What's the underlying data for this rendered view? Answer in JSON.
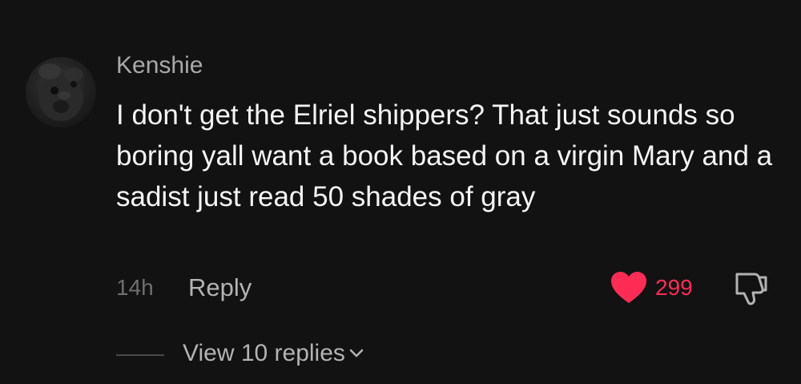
{
  "comment": {
    "username": "Kenshie",
    "text": "I don't get the Elriel shippers? That just sounds so boring yall want a book based on a virgin Mary and a sadist just read 50 shades of gray",
    "time": "14h",
    "reply_label": "Reply",
    "like_count": "299",
    "view_replies_label": "View 10 replies"
  },
  "icons": {
    "like": "heart-icon",
    "dislike": "thumbs-down-icon",
    "expand": "chevron-down-icon"
  },
  "colors": {
    "background": "#121212",
    "username": "#a9a9a9",
    "text": "#f5f5f5",
    "like_accent": "#fe2c55",
    "muted": "#6f6f6f"
  }
}
